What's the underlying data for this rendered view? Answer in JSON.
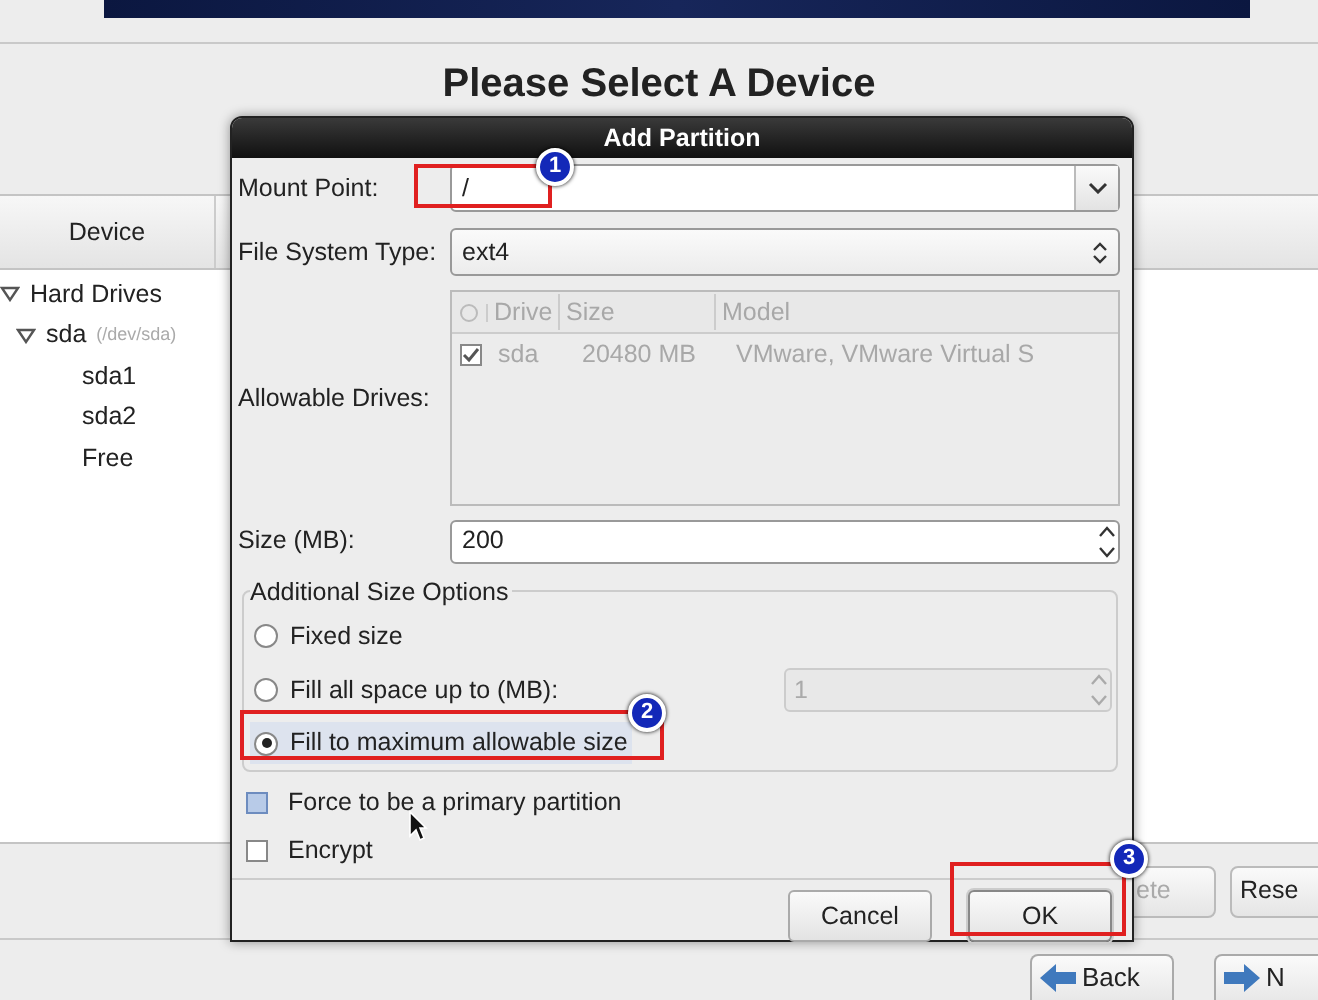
{
  "background": {
    "title": "Please Select A Device",
    "device_header": "Device",
    "tree": [
      {
        "label": "Hard Drives",
        "expanded": true,
        "children": [
          {
            "label": "sda",
            "note": "(/dev/sda)",
            "expanded": true,
            "children": [
              {
                "label": "sda1"
              },
              {
                "label": "sda2"
              },
              {
                "label": "Free"
              }
            ]
          }
        ]
      }
    ],
    "buttons": [
      {
        "label": "ete",
        "disabled": true
      },
      {
        "label": "Rese",
        "disabled": false
      }
    ],
    "nav_buttons": [
      {
        "label": "Back",
        "kind": "back"
      },
      {
        "label": "N",
        "kind": "next"
      }
    ]
  },
  "dialog": {
    "title": "Add Partition",
    "mount_point": {
      "label": "Mount Point:",
      "value": "/"
    },
    "file_system_type": {
      "label": "File System Type:",
      "value": "ext4"
    },
    "allowable_drives": {
      "label": "Allowable Drives:",
      "disabled": true,
      "columns": [
        "Drive",
        "Size",
        "Model"
      ],
      "rows": [
        {
          "checked": true,
          "drive": "sda",
          "size": "20480 MB",
          "model": "VMware, VMware Virtual S"
        }
      ]
    },
    "size": {
      "label": "Size (MB):",
      "value": "200"
    },
    "size_options": {
      "title": "Additional Size Options",
      "options": [
        {
          "label": "Fixed size",
          "selected": false
        },
        {
          "label": "Fill all space up to (MB):",
          "selected": false,
          "spin_value": "1",
          "spin_disabled": true
        },
        {
          "label": "Fill to maximum allowable size",
          "selected": true
        }
      ]
    },
    "checkboxes": [
      {
        "label": "Force to be a primary partition",
        "checked": false,
        "hovered": true
      },
      {
        "label": "Encrypt",
        "checked": false,
        "hovered": false
      }
    ],
    "buttons": [
      {
        "label": "Cancel",
        "kind": "cancel"
      },
      {
        "label": "OK",
        "kind": "ok"
      }
    ]
  },
  "annotations": [
    {
      "number": "1"
    },
    {
      "number": "2"
    },
    {
      "number": "3"
    }
  ]
}
